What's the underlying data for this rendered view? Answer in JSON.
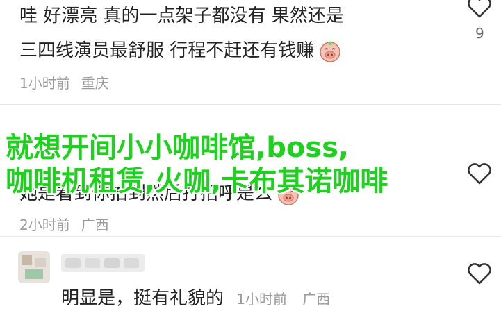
{
  "comment1": {
    "line1": "哇 好漂亮 真的一点架子都没有 果然还是",
    "line2": "三四线演员最舒服 行程不赶还有钱赚",
    "emoji_icon": "pig-face-icon",
    "time": "1小时前",
    "location": "重庆",
    "like_count": "9"
  },
  "comment2": {
    "line1": "她是看到你拍到然后打招呼是么",
    "emoji_icon": "pig-face-icon",
    "time": "2小时前",
    "location": "广西"
  },
  "overlay": {
    "line1": "就想开间小小咖啡馆,boss,",
    "line2": "咖啡机租赁,火咖,卡布其诺咖啡",
    "color": "#1ed11e"
  },
  "reply": {
    "username_blurred": "努力向陽",
    "text": "明显是，挺有礼貌的",
    "time": "1小时前",
    "location": "广西"
  }
}
